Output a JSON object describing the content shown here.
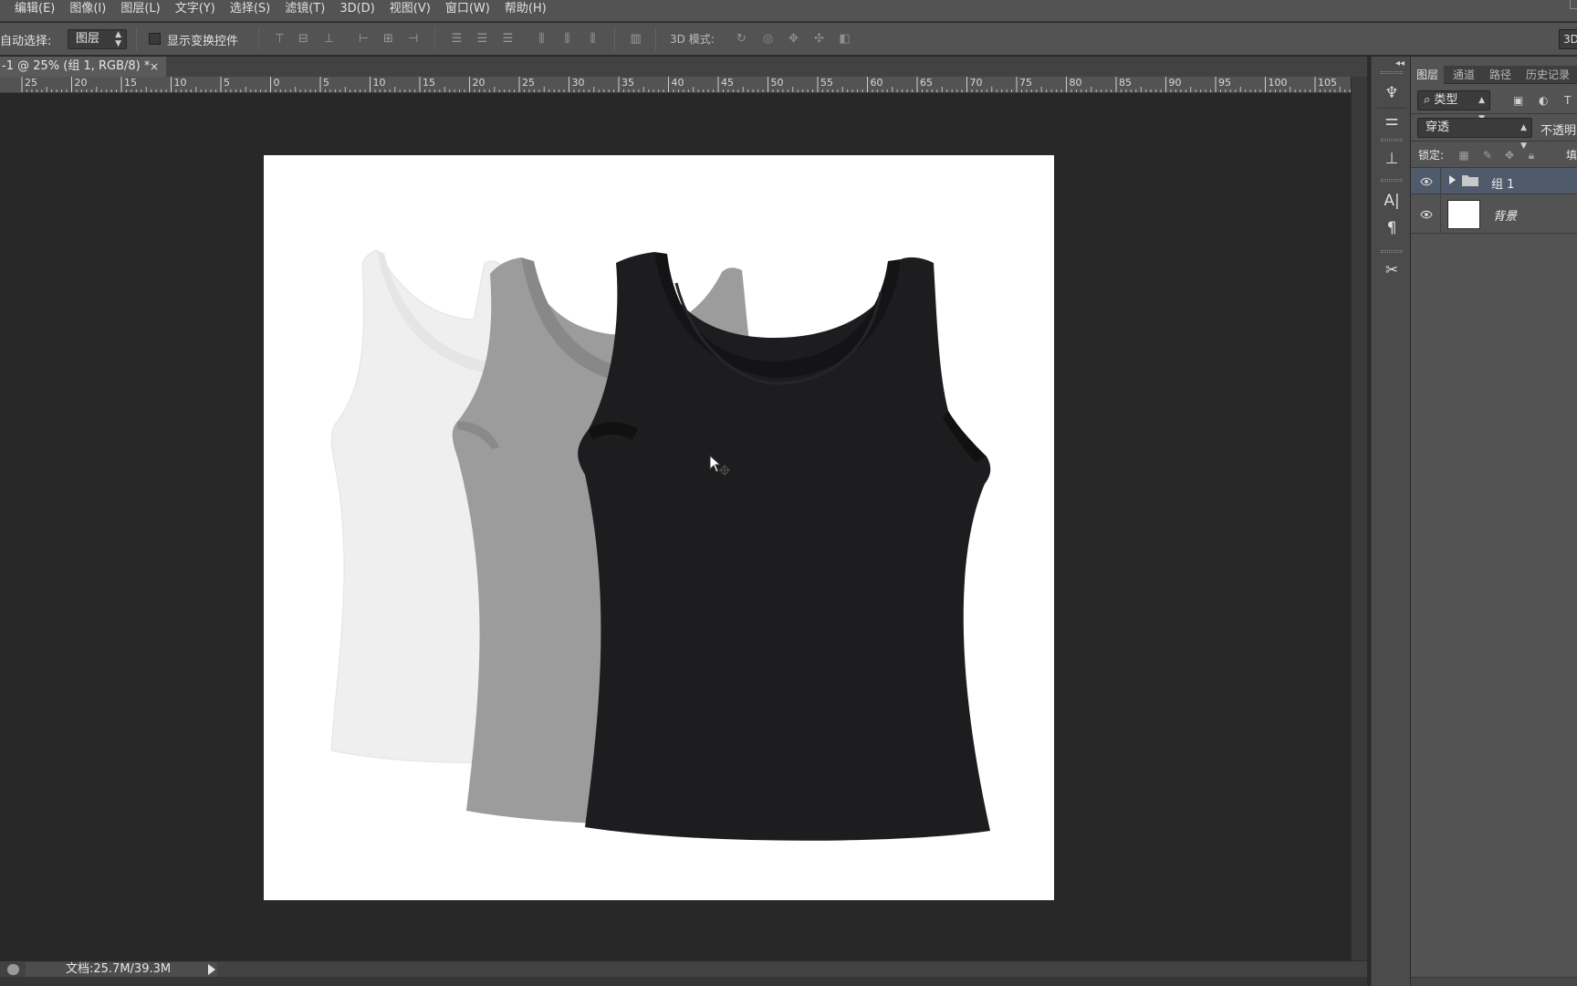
{
  "menu": [
    "编辑(E)",
    "图像(I)",
    "图层(L)",
    "文字(Y)",
    "选择(S)",
    "滤镜(T)",
    "3D(D)",
    "视图(V)",
    "窗口(W)",
    "帮助(H)"
  ],
  "options": {
    "auto_select_label": "自动选择:",
    "auto_select_value": "图层",
    "show_transform_label": "显示变换控件",
    "mode3d_label": "3D 模式:",
    "right_button": "3D"
  },
  "document": {
    "tab_title": "-1 @ 25% (组 1, RGB/8) *",
    "close": "×",
    "status": "文档:25.7M/39.3M"
  },
  "ruler": {
    "labels": [
      "25",
      "20",
      "15",
      "10",
      "5",
      "0",
      "5",
      "10",
      "15",
      "20",
      "25",
      "30",
      "35",
      "40",
      "45",
      "50",
      "55",
      "60",
      "65",
      "70",
      "75",
      "80",
      "85",
      "90",
      "95",
      "100",
      "105"
    ]
  },
  "artboard": {
    "background": "#ffffff",
    "tops": [
      {
        "name": "white tank top",
        "color": "#edeeed"
      },
      {
        "name": "gray tank top",
        "color": "#9a9a9a"
      },
      {
        "name": "black tank top",
        "color": "#1c1c1e"
      }
    ]
  },
  "layers_panel": {
    "tabs": [
      "图层",
      "通道",
      "路径",
      "历史记录"
    ],
    "filter": "类型",
    "blend_mode": "穿透",
    "opacity_label": "不透明",
    "lock_label": "锁定:",
    "fill_label": "填",
    "layers": [
      {
        "name": "组 1",
        "type": "group",
        "visible": true,
        "selected": true
      },
      {
        "name": "背景",
        "type": "background",
        "visible": true,
        "selected": false
      }
    ]
  },
  "colors": {
    "ui_dark": "#282828",
    "panel": "#535353",
    "selected_layer": "#4f5a6a"
  }
}
